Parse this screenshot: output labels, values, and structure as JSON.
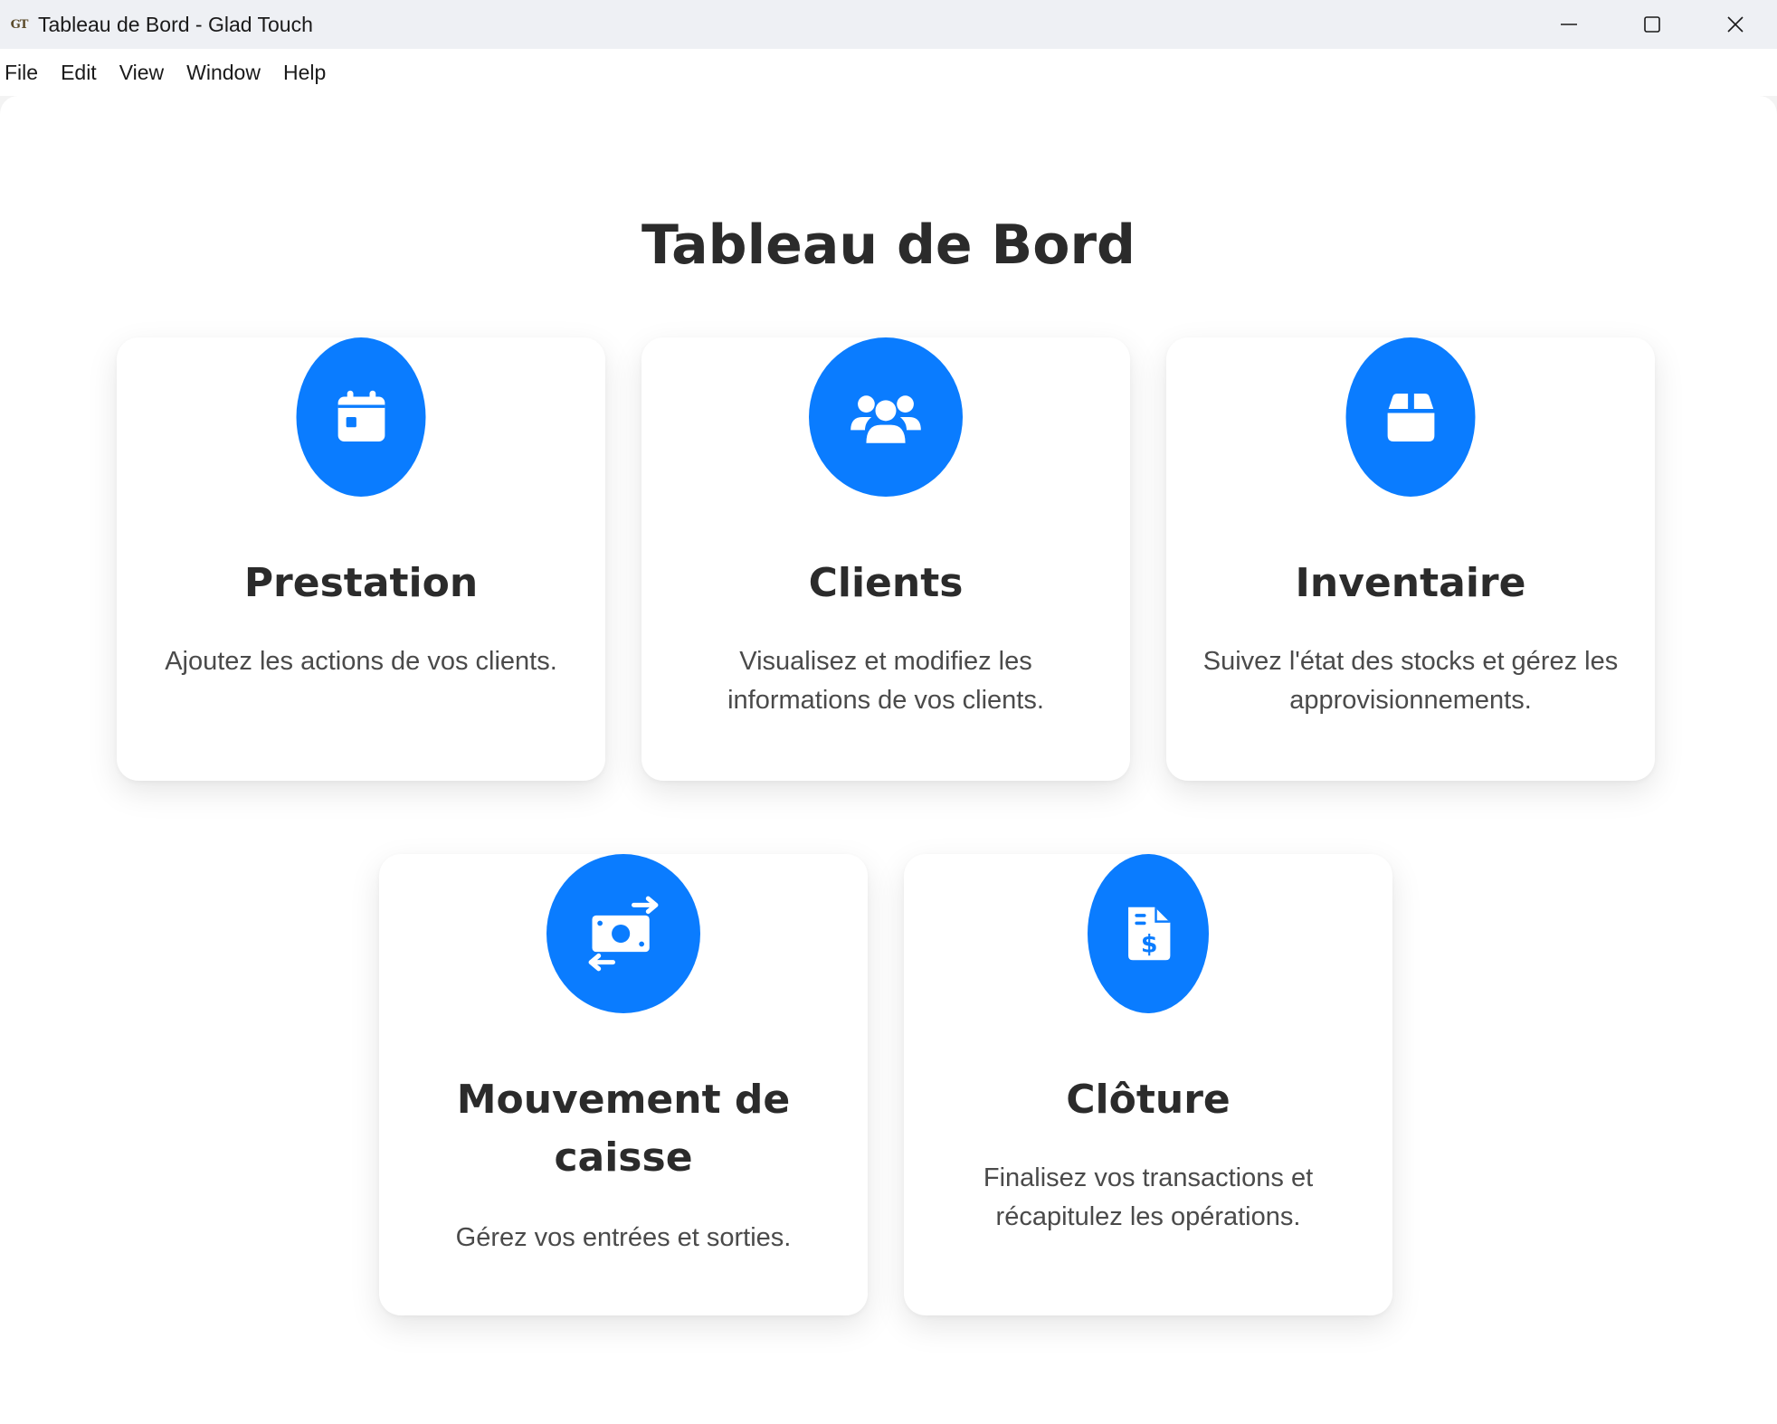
{
  "window": {
    "title": "Tableau de Bord - Glad Touch",
    "app_icon_text": "GT"
  },
  "menu": [
    "File",
    "Edit",
    "View",
    "Window",
    "Help"
  ],
  "page": {
    "title": "Tableau de Bord"
  },
  "cards": [
    {
      "title": "Prestation",
      "description": "Ajoutez les actions de vos clients.",
      "icon": "calendar-icon"
    },
    {
      "title": "Clients",
      "description": "Visualisez et modifiez les informations de vos clients.",
      "icon": "users-icon"
    },
    {
      "title": "Inventaire",
      "description": "Suivez l'état des stocks et gérez les approvisionnements.",
      "icon": "box-icon"
    },
    {
      "title": "Mouvement de caisse",
      "description": "Gérez vos entrées et sorties.",
      "icon": "money-exchange-icon"
    },
    {
      "title": "Clôture",
      "description": "Finalisez vos transactions et récapitulez les opérations.",
      "icon": "invoice-dollar-icon"
    }
  ],
  "colors": {
    "accent": "#0a7cff",
    "title_text": "#2b2b2b",
    "desc_text": "#4a4a4a"
  }
}
